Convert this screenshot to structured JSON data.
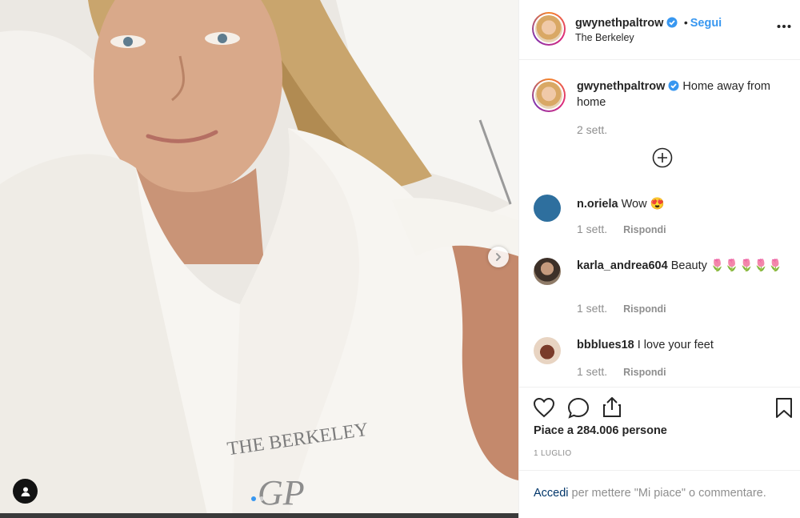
{
  "post": {
    "author": "gwynethpaltrow",
    "follow_label": "Segui",
    "separator": "•",
    "location": "The Berkeley",
    "caption_text": "Home away from home",
    "caption_time": "2 sett.",
    "robe_text": "THE BERKELEY",
    "robe_monogram": "GP"
  },
  "comments": [
    {
      "user": "n.oriela",
      "text": "Wow 😍",
      "time": "1 sett.",
      "reply_label": "Rispondi",
      "avatar_color": "#2e6f9e"
    },
    {
      "user": "karla_andrea604",
      "text": "Beauty 🌷🌷🌷🌷🌷",
      "time": "1 sett.",
      "reply_label": "Rispondi",
      "avatar_color": "#6b5a4c"
    },
    {
      "user": "bbblues18",
      "text": "I love your feet",
      "time": "1 sett.",
      "reply_label": "Rispondi",
      "avatar_color": "#c9a27c"
    }
  ],
  "actions": {
    "likes_text": "Piace a 284.006 persone",
    "date_text": "1 LUGLIO",
    "login_link": "Accedi",
    "login_rest": " per mettere \"Mi piace\" o commentare."
  },
  "colors": {
    "accent": "#3897f0",
    "text": "#262626",
    "muted": "#8e8e8e",
    "link": "#003569"
  },
  "icons": [
    "more-icon",
    "verified-icon",
    "load-more-icon",
    "heart-icon",
    "comment-icon",
    "share-icon",
    "bookmark-icon",
    "next-arrow-icon",
    "user-tag-icon"
  ]
}
